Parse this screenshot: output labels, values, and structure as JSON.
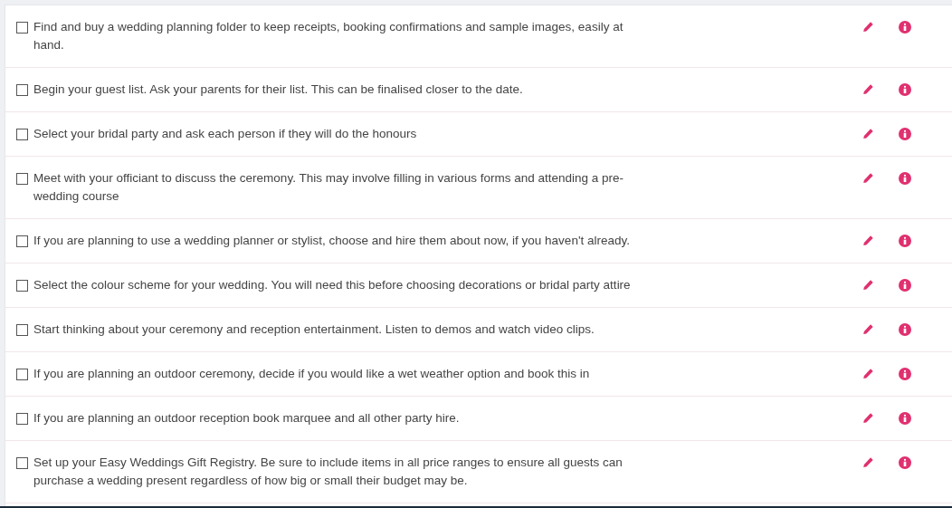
{
  "tasks": [
    {
      "text": "Find and buy a wedding planning folder to keep receipts, booking confirmations and sample images, easily at hand.",
      "checked": false
    },
    {
      "text": "Begin your guest list. Ask your parents for their list. This can be finalised closer to the date.",
      "checked": false
    },
    {
      "text": "Select your bridal party and ask each person if they will do the honours",
      "checked": false
    },
    {
      "text": "Meet with your officiant to discuss the ceremony. This may involve filling in various forms and attending a pre-wedding course",
      "checked": false
    },
    {
      "text": "If you are planning to use a wedding planner or stylist, choose and hire them about now, if you haven't already.",
      "checked": false
    },
    {
      "text": "Select the colour scheme for your wedding. You will need this before choosing decorations or bridal party attire",
      "checked": false
    },
    {
      "text": "Start thinking about your ceremony and reception entertainment. Listen to demos and watch video clips.",
      "checked": false
    },
    {
      "text": "If you are planning an outdoor ceremony, decide if you would like a wet weather option and book this in",
      "checked": false
    },
    {
      "text": "If you are planning an outdoor reception book marquee and all other party hire.",
      "checked": false
    },
    {
      "text": "Set up your Easy Weddings Gift Registry. Be sure to include items in all price ranges to ensure all guests can purchase a wedding present regardless of how big or small their budget may be.",
      "checked": false
    }
  ]
}
